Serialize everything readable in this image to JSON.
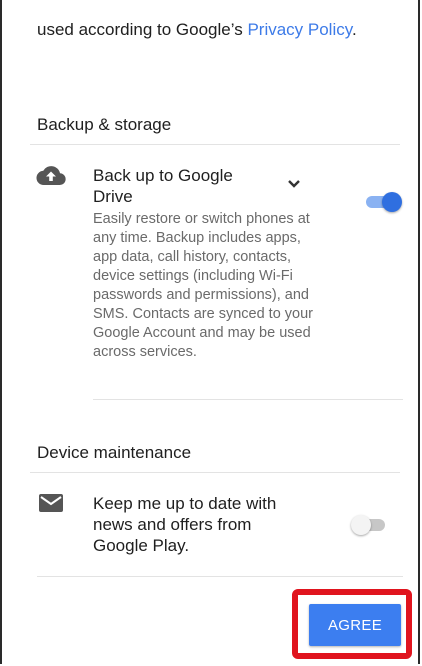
{
  "intro": {
    "text": "used according to Google’s ",
    "link_label": "Privacy Policy",
    "suffix": "."
  },
  "backup_section": {
    "title": "Backup & storage",
    "item": {
      "icon": "cloud-upload-icon",
      "title": "Back up to Google Drive",
      "description": "Easily restore or switch phones at any time. Backup includes apps, app data, call history, contacts, device settings (including Wi-Fi passwords and permissions), and SMS. Contacts are synced to your Google Account and may be used across services.",
      "expand_icon": "chevron-down-icon",
      "enabled": true
    }
  },
  "maintenance_section": {
    "title": "Device maintenance",
    "item": {
      "icon": "mail-icon",
      "title": "Keep me up to date with news and offers from Google Play.",
      "enabled": false
    }
  },
  "footer": {
    "agree_label": "AGREE"
  },
  "colors": {
    "accent": "#3c7ef0",
    "link": "#3d7be8",
    "highlight": "#e0141e"
  }
}
